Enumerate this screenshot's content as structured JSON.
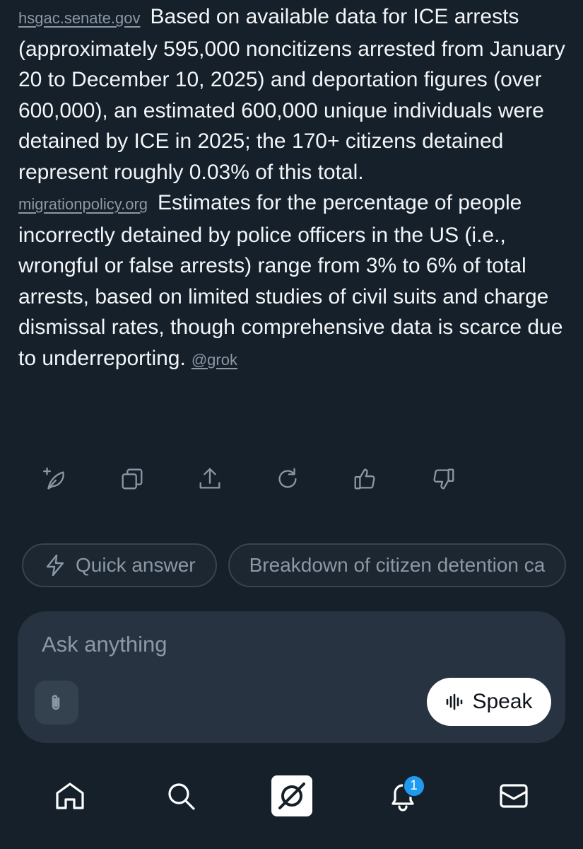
{
  "answer": {
    "paragraphs": [
      {
        "source": "hsgac.senate.gov",
        "text": "Based on available data for ICE arrests (approximately 595,000 noncitizens arrested from January 20 to December 10, 2025) and deportation figures (over 600,000), an estimated 600,000 unique individuals were detained by ICE in 2025; the 170+ citizens detained represent roughly 0.03% of this total."
      },
      {
        "source": "migrationpolicy.org",
        "text": "Estimates for the percentage of people incorrectly detained by police officers in the US (i.e., wrongful or false arrests) range from 3% to 6% of total arrests, based on limited studies of civil suits and charge dismissal rates, though comprehensive data is scarce due to underreporting.",
        "mention": "@grok"
      }
    ]
  },
  "actions": {
    "icons": [
      "feather-plus-icon",
      "copy-icon",
      "share-icon",
      "regenerate-icon",
      "thumbs-up-icon",
      "thumbs-down-icon"
    ]
  },
  "suggestions": [
    {
      "label": "Quick answer",
      "icon": "lightning-icon"
    },
    {
      "label": "Breakdown of citizen detention ca"
    }
  ],
  "composer": {
    "placeholder": "Ask anything",
    "speak_label": "Speak"
  },
  "tabbar": {
    "notifications_badge": "1"
  },
  "colors": {
    "background": "#15202b",
    "composer": "#273340",
    "muted_text": "#8b98a5",
    "badge": "#1d9bf0"
  }
}
